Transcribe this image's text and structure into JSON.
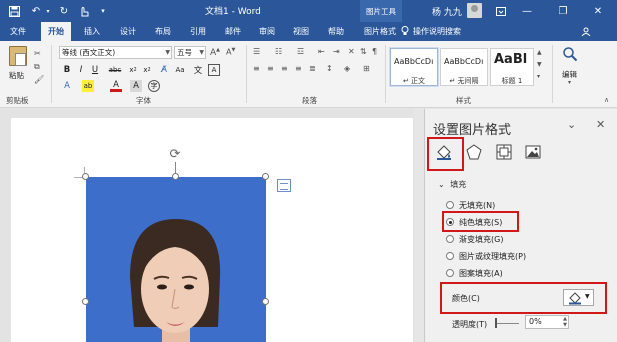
{
  "titlebar": {
    "doc_title": "文档1 - Word",
    "context_tab": "图片工具",
    "user": "杨 九九",
    "minimize": "—",
    "restore": "❐",
    "close": "✕"
  },
  "tabs": {
    "items": [
      "文件",
      "开始",
      "插入",
      "设计",
      "布局",
      "引用",
      "邮件",
      "审阅",
      "视图",
      "帮助",
      "图片格式"
    ],
    "active": "开始",
    "search": "操作说明搜索"
  },
  "ribbon": {
    "paste": "粘贴",
    "font_name": "等线 (西文正文)",
    "font_size": "五号",
    "groups": [
      "剪贴板",
      "字体",
      "段落",
      "样式"
    ],
    "styles": [
      {
        "sample": "AaBbCcDı",
        "name": "↵ 正文"
      },
      {
        "sample": "AaBbCcDı",
        "name": "↵ 无间隔"
      },
      {
        "sample": "AaBl",
        "name": "标题 1"
      }
    ],
    "edit": "编辑"
  },
  "pane": {
    "title": "设置图片格式",
    "section": "填充",
    "options": [
      {
        "label": "无填充(N)",
        "selected": false
      },
      {
        "label": "纯色填充(S)",
        "selected": true
      },
      {
        "label": "渐变填充(G)",
        "selected": false
      },
      {
        "label": "图片或纹理填充(P)",
        "selected": false
      },
      {
        "label": "图案填充(A)",
        "selected": false
      }
    ],
    "color_label": "颜色(C)",
    "transparency_label": "透明度(T)",
    "transparency_value": "0%",
    "transparency_fraction": 0
  },
  "colors": {
    "ribbon_blue": "#2b579a",
    "photo_bg": "#3d6ec9",
    "highlight_red": "#d01818"
  }
}
